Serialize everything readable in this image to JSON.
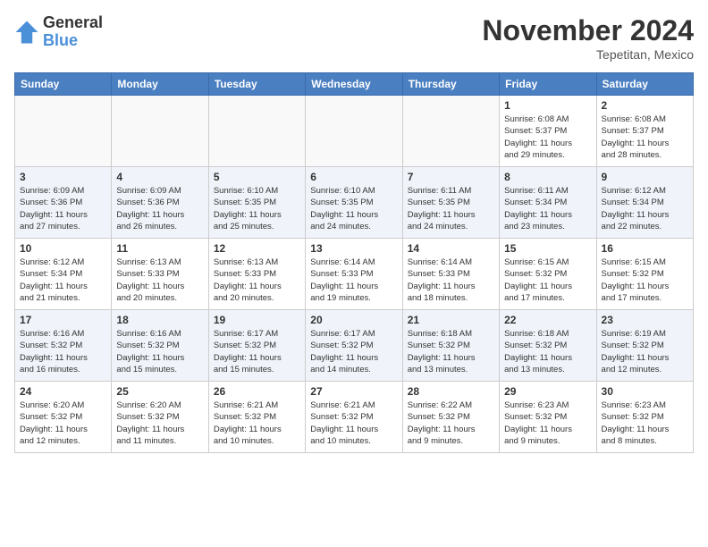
{
  "header": {
    "logo_general": "General",
    "logo_blue": "Blue",
    "month_title": "November 2024",
    "location": "Tepetitan, Mexico"
  },
  "calendar": {
    "days_of_week": [
      "Sunday",
      "Monday",
      "Tuesday",
      "Wednesday",
      "Thursday",
      "Friday",
      "Saturday"
    ],
    "weeks": [
      [
        {
          "day": "",
          "info": ""
        },
        {
          "day": "",
          "info": ""
        },
        {
          "day": "",
          "info": ""
        },
        {
          "day": "",
          "info": ""
        },
        {
          "day": "",
          "info": ""
        },
        {
          "day": "1",
          "info": "Sunrise: 6:08 AM\nSunset: 5:37 PM\nDaylight: 11 hours\nand 29 minutes."
        },
        {
          "day": "2",
          "info": "Sunrise: 6:08 AM\nSunset: 5:37 PM\nDaylight: 11 hours\nand 28 minutes."
        }
      ],
      [
        {
          "day": "3",
          "info": "Sunrise: 6:09 AM\nSunset: 5:36 PM\nDaylight: 11 hours\nand 27 minutes."
        },
        {
          "day": "4",
          "info": "Sunrise: 6:09 AM\nSunset: 5:36 PM\nDaylight: 11 hours\nand 26 minutes."
        },
        {
          "day": "5",
          "info": "Sunrise: 6:10 AM\nSunset: 5:35 PM\nDaylight: 11 hours\nand 25 minutes."
        },
        {
          "day": "6",
          "info": "Sunrise: 6:10 AM\nSunset: 5:35 PM\nDaylight: 11 hours\nand 24 minutes."
        },
        {
          "day": "7",
          "info": "Sunrise: 6:11 AM\nSunset: 5:35 PM\nDaylight: 11 hours\nand 24 minutes."
        },
        {
          "day": "8",
          "info": "Sunrise: 6:11 AM\nSunset: 5:34 PM\nDaylight: 11 hours\nand 23 minutes."
        },
        {
          "day": "9",
          "info": "Sunrise: 6:12 AM\nSunset: 5:34 PM\nDaylight: 11 hours\nand 22 minutes."
        }
      ],
      [
        {
          "day": "10",
          "info": "Sunrise: 6:12 AM\nSunset: 5:34 PM\nDaylight: 11 hours\nand 21 minutes."
        },
        {
          "day": "11",
          "info": "Sunrise: 6:13 AM\nSunset: 5:33 PM\nDaylight: 11 hours\nand 20 minutes."
        },
        {
          "day": "12",
          "info": "Sunrise: 6:13 AM\nSunset: 5:33 PM\nDaylight: 11 hours\nand 20 minutes."
        },
        {
          "day": "13",
          "info": "Sunrise: 6:14 AM\nSunset: 5:33 PM\nDaylight: 11 hours\nand 19 minutes."
        },
        {
          "day": "14",
          "info": "Sunrise: 6:14 AM\nSunset: 5:33 PM\nDaylight: 11 hours\nand 18 minutes."
        },
        {
          "day": "15",
          "info": "Sunrise: 6:15 AM\nSunset: 5:32 PM\nDaylight: 11 hours\nand 17 minutes."
        },
        {
          "day": "16",
          "info": "Sunrise: 6:15 AM\nSunset: 5:32 PM\nDaylight: 11 hours\nand 17 minutes."
        }
      ],
      [
        {
          "day": "17",
          "info": "Sunrise: 6:16 AM\nSunset: 5:32 PM\nDaylight: 11 hours\nand 16 minutes."
        },
        {
          "day": "18",
          "info": "Sunrise: 6:16 AM\nSunset: 5:32 PM\nDaylight: 11 hours\nand 15 minutes."
        },
        {
          "day": "19",
          "info": "Sunrise: 6:17 AM\nSunset: 5:32 PM\nDaylight: 11 hours\nand 15 minutes."
        },
        {
          "day": "20",
          "info": "Sunrise: 6:17 AM\nSunset: 5:32 PM\nDaylight: 11 hours\nand 14 minutes."
        },
        {
          "day": "21",
          "info": "Sunrise: 6:18 AM\nSunset: 5:32 PM\nDaylight: 11 hours\nand 13 minutes."
        },
        {
          "day": "22",
          "info": "Sunrise: 6:18 AM\nSunset: 5:32 PM\nDaylight: 11 hours\nand 13 minutes."
        },
        {
          "day": "23",
          "info": "Sunrise: 6:19 AM\nSunset: 5:32 PM\nDaylight: 11 hours\nand 12 minutes."
        }
      ],
      [
        {
          "day": "24",
          "info": "Sunrise: 6:20 AM\nSunset: 5:32 PM\nDaylight: 11 hours\nand 12 minutes."
        },
        {
          "day": "25",
          "info": "Sunrise: 6:20 AM\nSunset: 5:32 PM\nDaylight: 11 hours\nand 11 minutes."
        },
        {
          "day": "26",
          "info": "Sunrise: 6:21 AM\nSunset: 5:32 PM\nDaylight: 11 hours\nand 10 minutes."
        },
        {
          "day": "27",
          "info": "Sunrise: 6:21 AM\nSunset: 5:32 PM\nDaylight: 11 hours\nand 10 minutes."
        },
        {
          "day": "28",
          "info": "Sunrise: 6:22 AM\nSunset: 5:32 PM\nDaylight: 11 hours\nand 9 minutes."
        },
        {
          "day": "29",
          "info": "Sunrise: 6:23 AM\nSunset: 5:32 PM\nDaylight: 11 hours\nand 9 minutes."
        },
        {
          "day": "30",
          "info": "Sunrise: 6:23 AM\nSunset: 5:32 PM\nDaylight: 11 hours\nand 8 minutes."
        }
      ]
    ]
  }
}
